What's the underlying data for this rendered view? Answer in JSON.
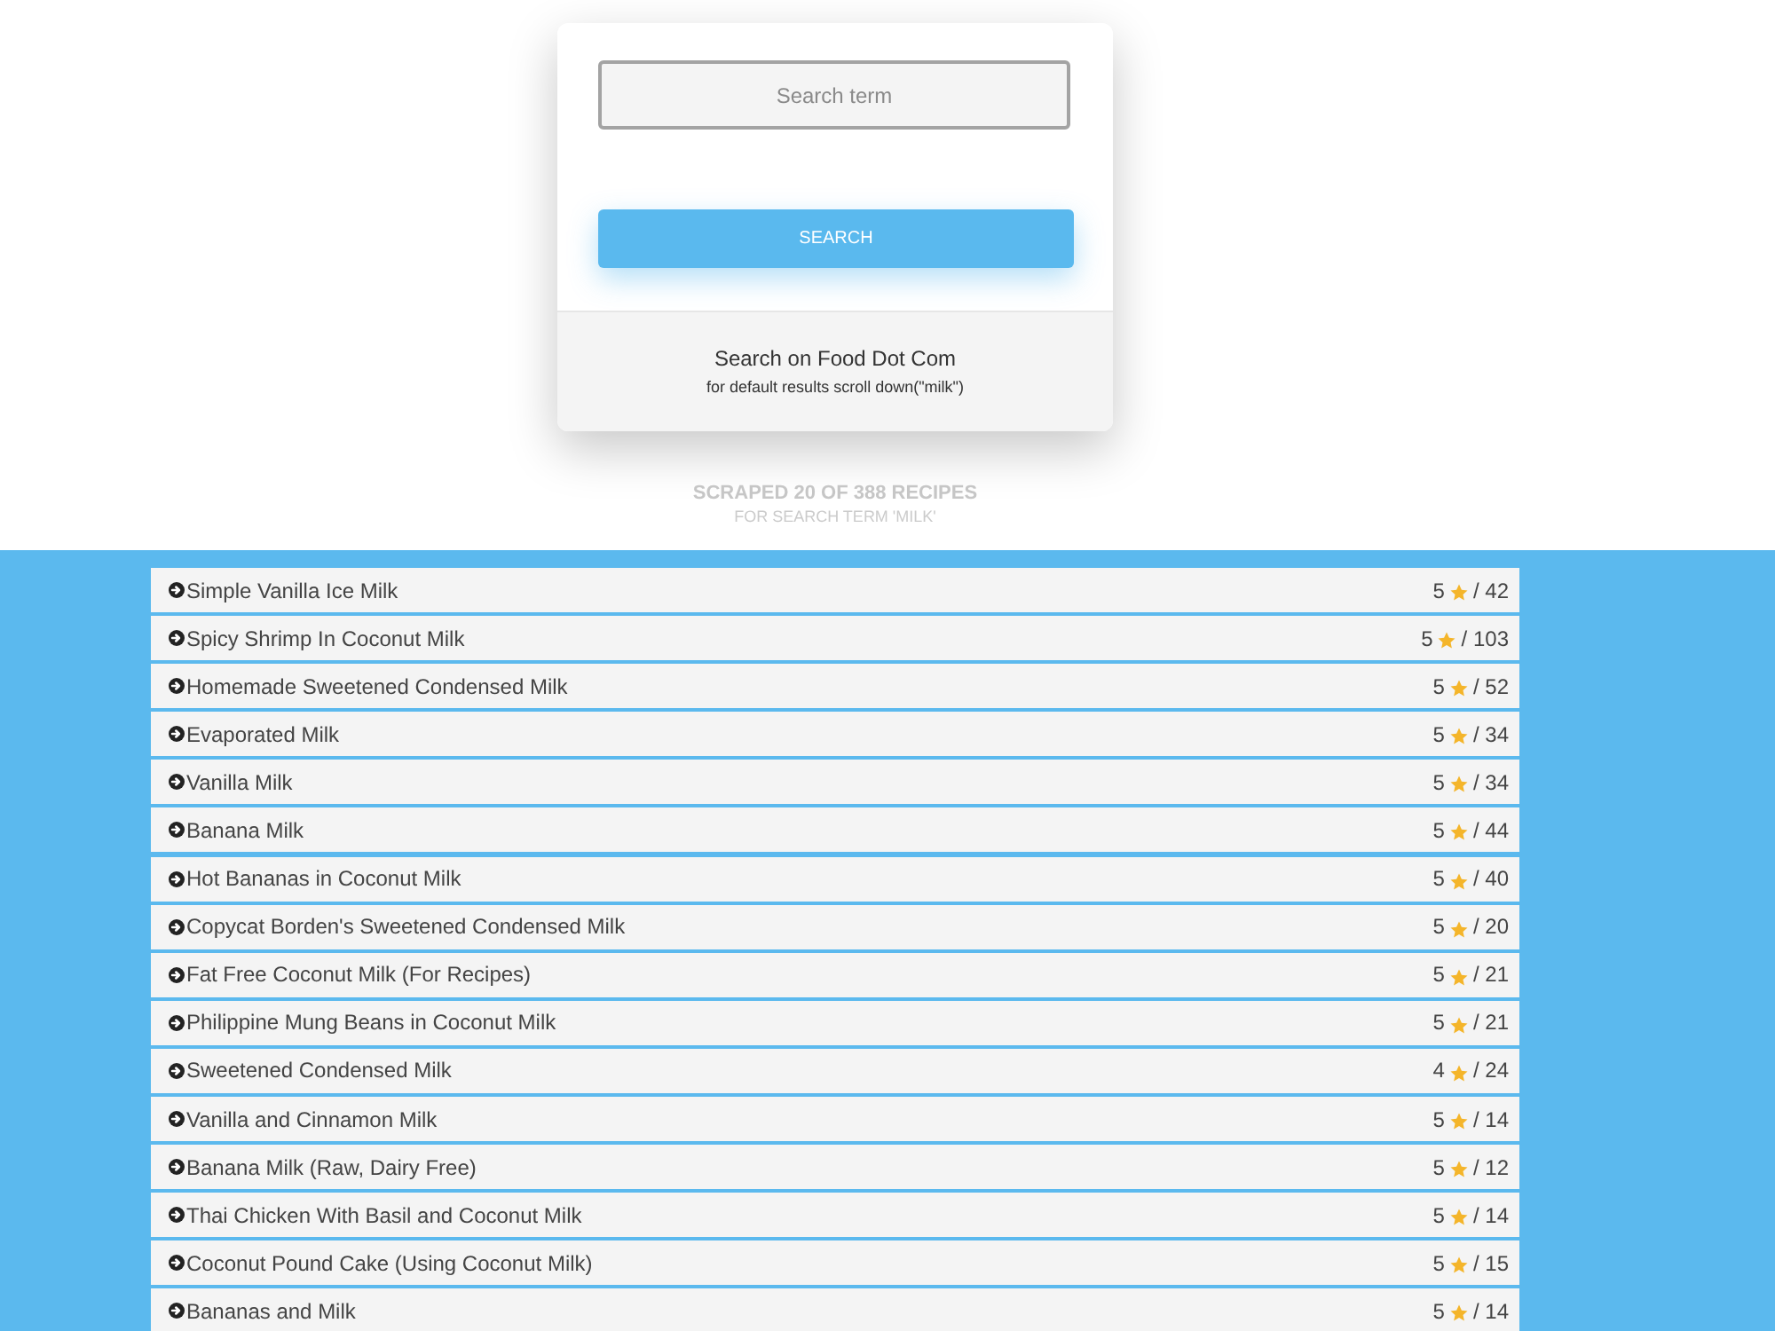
{
  "search": {
    "placeholder": "Search term",
    "button": "SEARCH"
  },
  "card_footer": {
    "title": "Search on Food Dot Com",
    "note": "for default results scroll down(\"milk\")"
  },
  "stats": {
    "headline": "SCRAPED 20 OF 388 RECIPES",
    "subline": "FOR SEARCH TERM 'MILK'"
  },
  "recipes": [
    {
      "name": "Simple Vanilla Ice Milk",
      "rating": "5",
      "count": "/ 42"
    },
    {
      "name": "Spicy Shrimp In Coconut Milk",
      "rating": "5",
      "count": "/ 103"
    },
    {
      "name": "Homemade Sweetened Condensed Milk",
      "rating": "5",
      "count": "/ 52"
    },
    {
      "name": "Evaporated Milk",
      "rating": "5",
      "count": "/ 34"
    },
    {
      "name": "Vanilla Milk",
      "rating": "5",
      "count": "/ 34"
    },
    {
      "name": "Banana Milk",
      "rating": "5",
      "count": "/ 44"
    },
    {
      "name": "Hot Bananas in Coconut Milk",
      "rating": "5",
      "count": "/ 40"
    },
    {
      "name": "Copycat Borden's Sweetened Condensed Milk",
      "rating": "5",
      "count": "/ 20"
    },
    {
      "name": "Fat Free Coconut Milk (For Recipes)",
      "rating": "5",
      "count": "/ 21"
    },
    {
      "name": "Philippine Mung Beans in Coconut Milk",
      "rating": "5",
      "count": "/ 21"
    },
    {
      "name": "Sweetened Condensed Milk",
      "rating": "4",
      "count": "/ 24"
    },
    {
      "name": "Vanilla and Cinnamon Milk",
      "rating": "5",
      "count": "/ 14"
    },
    {
      "name": "Banana Milk (Raw, Dairy Free)",
      "rating": "5",
      "count": "/ 12"
    },
    {
      "name": "Thai Chicken With Basil and Coconut Milk",
      "rating": "5",
      "count": "/ 14"
    },
    {
      "name": "Coconut Pound Cake (Using Coconut Milk)",
      "rating": "5",
      "count": "/ 15"
    },
    {
      "name": "Bananas and Milk",
      "rating": "5",
      "count": "/ 14"
    }
  ]
}
